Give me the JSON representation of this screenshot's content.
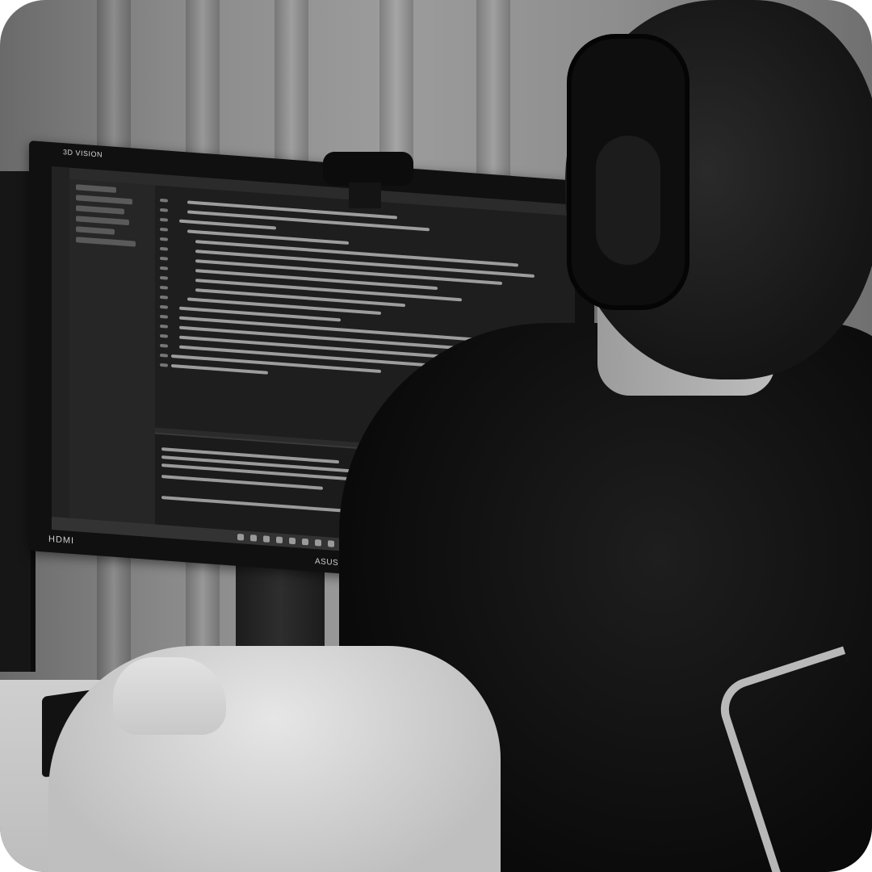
{
  "image": {
    "alt": "",
    "monitor": {
      "brand_label": "3D VISION",
      "port_label": "HDMI",
      "logo_label": "ASUS"
    },
    "palette": {
      "background": "#8e8e8e",
      "hoodie": "#111111",
      "sleeve": "#d8d8d8",
      "screen": "#1e1e1e"
    }
  }
}
